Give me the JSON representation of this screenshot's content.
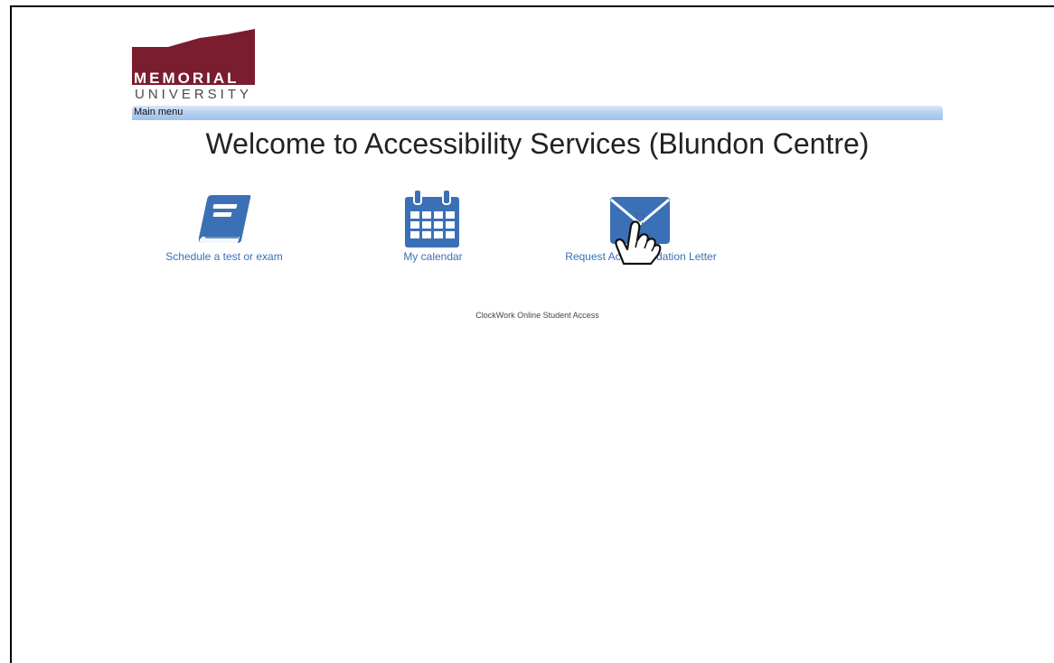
{
  "logo": {
    "line1": "MEMORIAL",
    "line2": "UNIVERSITY",
    "color": "#7a1d2e"
  },
  "menu": {
    "items": [
      {
        "label": "Main menu"
      }
    ],
    "bar_color": "#a9c7ec"
  },
  "page": {
    "title": "Welcome to Accessibility Services (Blundon Centre)"
  },
  "tiles": [
    {
      "label": "Schedule a test or exam",
      "icon": "book-icon"
    },
    {
      "label": "My calendar",
      "icon": "calendar-icon"
    },
    {
      "label": "Request Accommodation Letter",
      "icon": "envelope-icon"
    }
  ],
  "footer": {
    "text": "ClockWork Online Student Access"
  },
  "colors": {
    "icon_blue": "#3b70b6",
    "link_blue": "#3b70b6"
  }
}
